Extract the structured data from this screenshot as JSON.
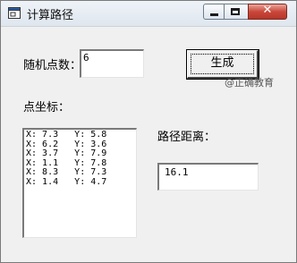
{
  "window": {
    "title": "计算路径",
    "minimize_glyph": "",
    "maximize_glyph": "",
    "close_glyph": "✕"
  },
  "form": {
    "count_label": "随机点数：",
    "count_value": "6",
    "generate_label": "生成",
    "watermark": "@正确教育",
    "coords_label": "点坐标：",
    "coords_lines": [
      "X: 7.3   Y: 5.8",
      "X: 6.2   Y: 3.6",
      "X: 3.7   Y: 7.9",
      "X: 1.1   Y: 7.8",
      "X: 8.3   Y: 7.3",
      "X: 1.4   Y: 4.7"
    ],
    "distance_label": "路径距离：",
    "distance_value": "16.1"
  },
  "icons": {
    "app_icon": "window-app-icon",
    "minimize": "minimize-icon",
    "maximize": "maximize-icon",
    "close": "close-icon"
  }
}
